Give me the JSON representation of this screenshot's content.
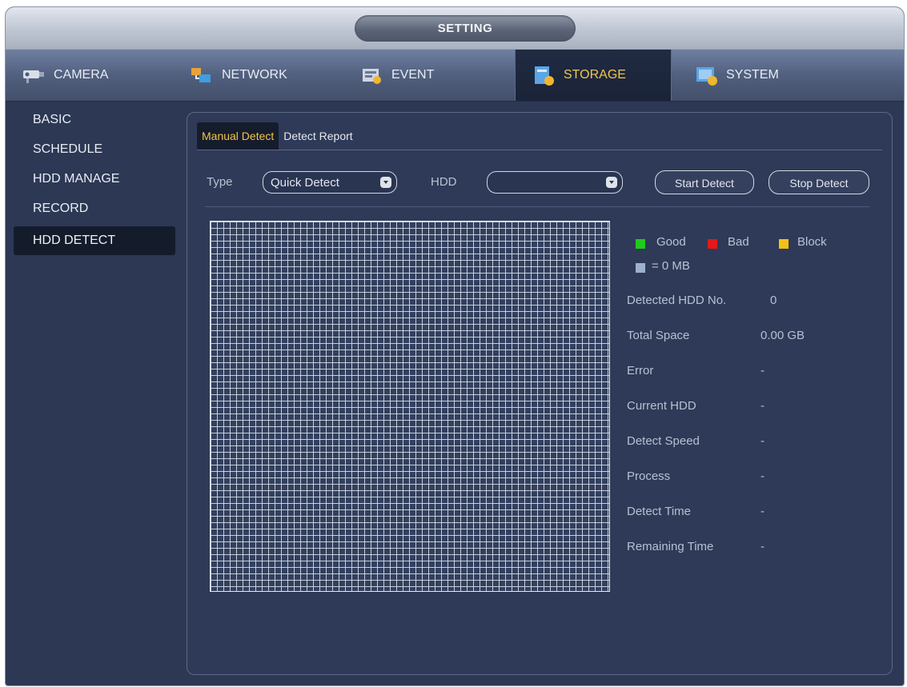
{
  "window": {
    "title": "SETTING"
  },
  "tabs": [
    {
      "label": "CAMERA",
      "icon": "camera-icon"
    },
    {
      "label": "NETWORK",
      "icon": "network-icon"
    },
    {
      "label": "EVENT",
      "icon": "event-icon"
    },
    {
      "label": "STORAGE",
      "icon": "storage-icon",
      "active": true
    },
    {
      "label": "SYSTEM",
      "icon": "system-icon"
    }
  ],
  "sidebar": {
    "items": [
      {
        "label": "BASIC"
      },
      {
        "label": "SCHEDULE"
      },
      {
        "label": "HDD MANAGE"
      },
      {
        "label": "RECORD"
      },
      {
        "label": "HDD DETECT",
        "active": true
      }
    ]
  },
  "subtabs": [
    {
      "label": "Manual Detect",
      "active": true
    },
    {
      "label": "Detect Report"
    }
  ],
  "controls": {
    "type_label": "Type",
    "type_value": "Quick Detect",
    "hdd_label": "HDD",
    "hdd_value": "",
    "start_button": "Start Detect",
    "stop_button": "Stop Detect"
  },
  "legend": {
    "good": {
      "label": "Good",
      "color": "#22c91e"
    },
    "bad": {
      "label": "Bad",
      "color": "#e3191b"
    },
    "block": {
      "label": "Block",
      "color": "#f4c116"
    },
    "unit": {
      "label": "= 0 MB",
      "color": "#9eb0cf"
    }
  },
  "info": {
    "detected_hdd_no": {
      "label": "Detected HDD No.",
      "value": "0"
    },
    "total_space": {
      "label": "Total Space",
      "value": "0.00 GB"
    },
    "error": {
      "label": "Error",
      "value": "-"
    },
    "current_hdd": {
      "label": "Current HDD",
      "value": "-"
    },
    "detect_speed": {
      "label": "Detect Speed",
      "value": "-"
    },
    "process": {
      "label": "Process",
      "value": "-"
    },
    "detect_time": {
      "label": "Detect Time",
      "value": "-"
    },
    "remaining_time": {
      "label": "Remaining Time",
      "value": "-"
    }
  }
}
